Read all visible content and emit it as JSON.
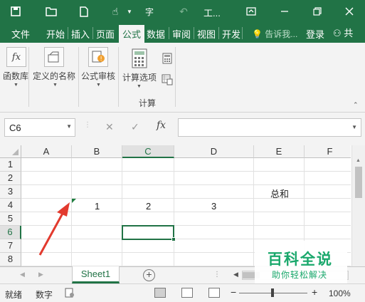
{
  "window": {
    "title": "工...",
    "accent": "#217346"
  },
  "quick_access": [
    "save-icon",
    "open-icon",
    "new-icon",
    "touch-mode-icon",
    "spelling-icon",
    "undo-icon"
  ],
  "window_controls": [
    "ribbon-display-icon",
    "minimize-icon",
    "restore-icon",
    "close-icon"
  ],
  "tabs": [
    {
      "label": "文件",
      "active": false
    },
    {
      "label": "开始",
      "active": false
    },
    {
      "label": "插入",
      "active": false
    },
    {
      "label": "页面",
      "active": false
    },
    {
      "label": "公式",
      "active": true
    },
    {
      "label": "数据",
      "active": false
    },
    {
      "label": "审阅",
      "active": false
    },
    {
      "label": "视图",
      "active": false
    },
    {
      "label": "开发",
      "active": false
    }
  ],
  "tell_me": "告诉我...",
  "login": "登录",
  "share": "共",
  "ribbon": {
    "function_library": "函数库",
    "defined_names": "定义的名称",
    "formula_auditing": "公式审核",
    "calc_options": "计算选项",
    "calc_group": "计算"
  },
  "formula_bar": {
    "name_box": "C6",
    "fx": "fx",
    "formula": ""
  },
  "columns": [
    "A",
    "B",
    "C",
    "D",
    "E",
    "F"
  ],
  "rows": [
    "1",
    "2",
    "3",
    "4",
    "5",
    "6",
    "7",
    "8"
  ],
  "selected_cell": "C6",
  "cells": {
    "E3": "总和",
    "B4": "1",
    "C4": "2",
    "D4": "3"
  },
  "sheets": [
    {
      "name": "Sheet1",
      "active": true
    }
  ],
  "add_sheet": "+",
  "status": {
    "ready": "就绪",
    "numlock": "数字",
    "zoom": "100%"
  },
  "watermark": {
    "title": "百科全说",
    "subtitle": "助你轻松解决"
  }
}
